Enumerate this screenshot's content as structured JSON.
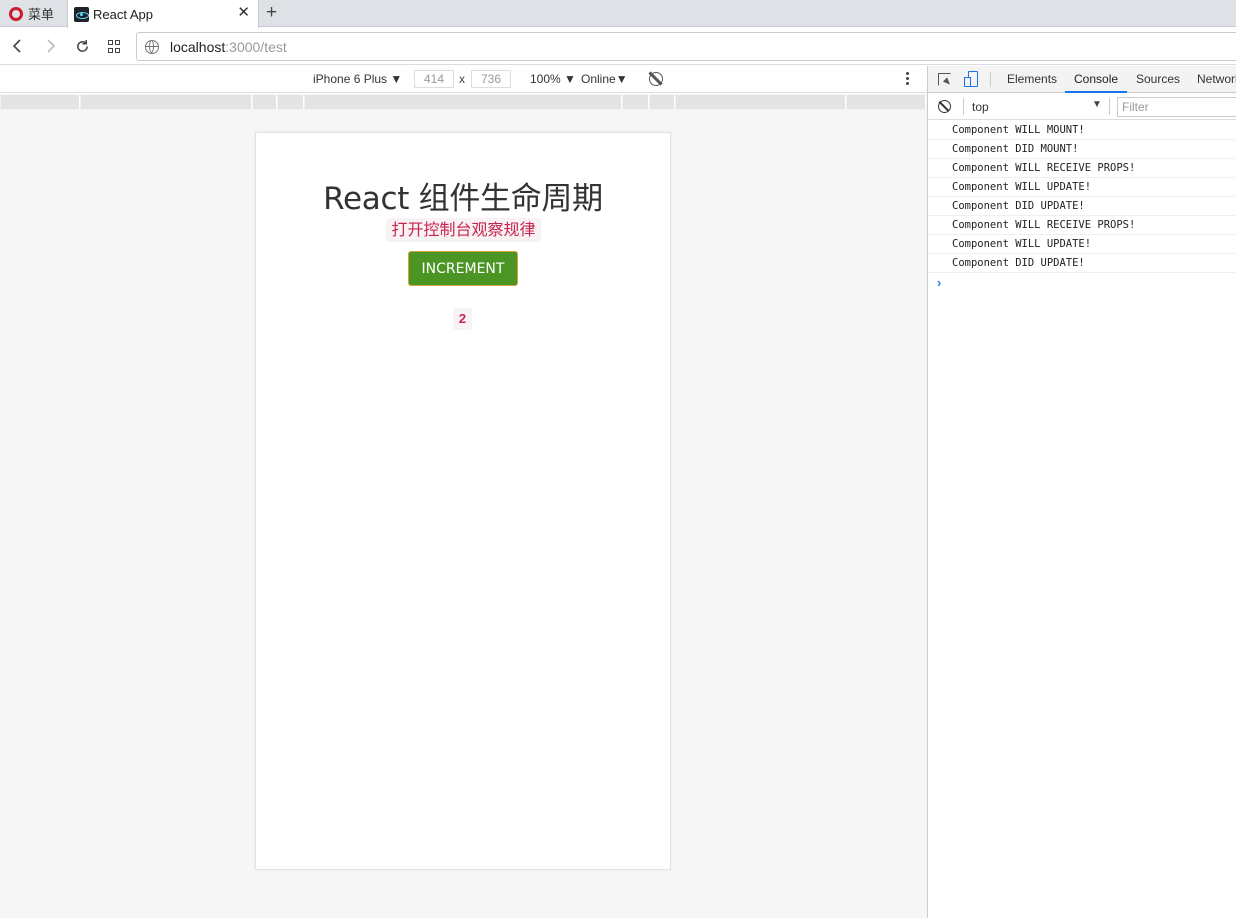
{
  "browser": {
    "menu_label": "菜单",
    "tab_title": "React App",
    "tab_close": "✕",
    "new_tab": "+",
    "url_host": "localhost",
    "url_path": ":3000/test"
  },
  "device_toolbar": {
    "device": "iPhone 6 Plus",
    "width": "414",
    "height": "736",
    "times": "x",
    "zoom": "100%",
    "network": "Online"
  },
  "app": {
    "title": "React 组件生命周期",
    "hint": "打开控制台观察规律",
    "button_label": "INCREMENT",
    "counter": "2",
    "button_color": "#4b9524"
  },
  "devtools": {
    "tabs": [
      "Elements",
      "Console",
      "Sources",
      "Network"
    ],
    "active_tab": "Console",
    "context": "top",
    "filter_placeholder": "Filter",
    "logs": [
      "Component WILL MOUNT!",
      "Component DID MOUNT!",
      "Component WILL RECEIVE PROPS!",
      "Component WILL UPDATE!",
      "Component DID UPDATE!",
      "Component WILL RECEIVE PROPS!",
      "Component WILL UPDATE!",
      "Component DID UPDATE!"
    ],
    "prompt": "›"
  }
}
